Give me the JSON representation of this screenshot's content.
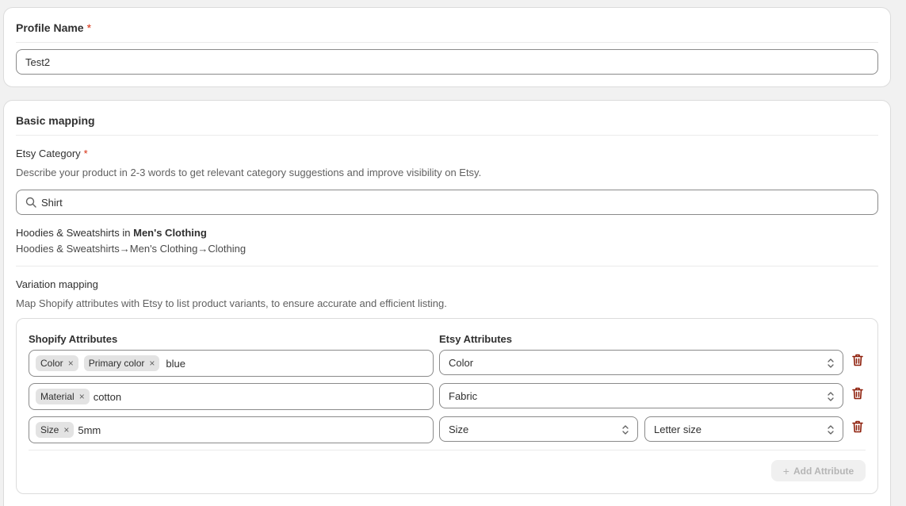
{
  "profile": {
    "title": "Profile Name",
    "required_mark": "*",
    "name_value": "Test2"
  },
  "mapping": {
    "title": "Basic mapping",
    "category": {
      "label": "Etsy Category",
      "required_mark": "*",
      "description": "Describe your product in 2-3 words to get relevant category suggestions and improve visibility on Etsy.",
      "search_value": "Shirt",
      "result_name": "Hoodies & Sweatshirts in ",
      "result_parent": "Men's Clothing",
      "result_path": "Hoodies & Sweatshirts→Men's Clothing→Clothing"
    },
    "variation": {
      "label": "Variation mapping",
      "description": "Map Shopify attributes with Etsy to list product variants, to ensure accurate and efficient listing.",
      "shopify_header": "Shopify Attributes",
      "etsy_header": "Etsy Attributes",
      "tag_remove": "×",
      "rows": [
        {
          "tags": [
            "Color",
            "Primary color"
          ],
          "text": "blue",
          "etsy": "Color",
          "etsy_sub": ""
        },
        {
          "tags": [
            "Material"
          ],
          "text": "cotton",
          "etsy": "Fabric",
          "etsy_sub": ""
        },
        {
          "tags": [
            "Size"
          ],
          "text": "5mm",
          "etsy": "Size",
          "etsy_sub": "Letter size"
        }
      ],
      "add_plus": "+",
      "add_label": "Add Attribute"
    }
  },
  "colors": {
    "delete_icon": "#8e1f0b",
    "required": "#d72c0d"
  },
  "icons": {
    "search": "search-icon",
    "select": "select-chevron-icon",
    "delete": "trash-icon",
    "remove_tag": "close-icon"
  }
}
